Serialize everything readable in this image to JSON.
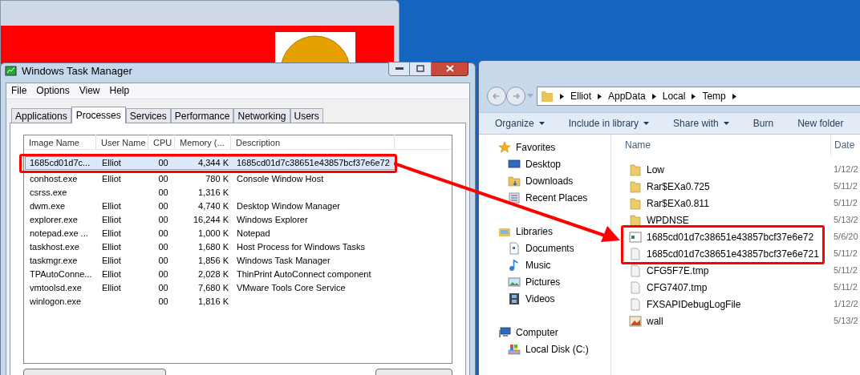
{
  "task_manager": {
    "title": "Windows Task Manager",
    "menu": [
      "File",
      "Options",
      "View",
      "Help"
    ],
    "tabs": [
      {
        "label": "Applications",
        "selected": false
      },
      {
        "label": "Processes",
        "selected": true
      },
      {
        "label": "Services",
        "selected": false
      },
      {
        "label": "Performance",
        "selected": false
      },
      {
        "label": "Networking",
        "selected": false
      },
      {
        "label": "Users",
        "selected": false
      }
    ],
    "columns": [
      "Image Name",
      "User Name",
      "CPU",
      "Memory (...",
      "Description"
    ],
    "rows": [
      {
        "cells": [
          "1685cd01d7c...",
          "Elliot",
          "00",
          "4,344 K",
          "1685cd01d7c38651e43857bcf37e6e72"
        ],
        "selected": true
      },
      {
        "cells": [
          "conhost.exe",
          "Elliot",
          "00",
          "780 K",
          "Console Window Host"
        ],
        "selected": false
      },
      {
        "cells": [
          "csrss.exe",
          "",
          "00",
          "1,316 K",
          ""
        ],
        "selected": false
      },
      {
        "cells": [
          "dwm.exe",
          "Elliot",
          "00",
          "4,740 K",
          "Desktop Window Manager"
        ],
        "selected": false
      },
      {
        "cells": [
          "explorer.exe",
          "Elliot",
          "00",
          "16,244 K",
          "Windows Explorer"
        ],
        "selected": false
      },
      {
        "cells": [
          "notepad.exe ...",
          "Elliot",
          "00",
          "1,000 K",
          "Notepad"
        ],
        "selected": false
      },
      {
        "cells": [
          "taskhost.exe",
          "Elliot",
          "00",
          "1,680 K",
          "Host Process for Windows Tasks"
        ],
        "selected": false
      },
      {
        "cells": [
          "taskmgr.exe",
          "Elliot",
          "00",
          "1,856 K",
          "Windows Task Manager"
        ],
        "selected": false
      },
      {
        "cells": [
          "TPAutoConne...",
          "Elliot",
          "00",
          "2,028 K",
          "ThinPrint AutoConnect component"
        ],
        "selected": false
      },
      {
        "cells": [
          "vmtoolsd.exe",
          "Elliot",
          "00",
          "7,680 K",
          "VMware Tools Core Service"
        ],
        "selected": false
      },
      {
        "cells": [
          "winlogon.exe",
          "",
          "00",
          "1,816 K",
          ""
        ],
        "selected": false
      }
    ]
  },
  "explorer": {
    "breadcrumb": [
      "Elliot",
      "AppData",
      "Local",
      "Temp"
    ],
    "toolbar": [
      {
        "label": "Organize",
        "dropdown": true
      },
      {
        "label": "Include in library",
        "dropdown": true
      },
      {
        "label": "Share with",
        "dropdown": true
      },
      {
        "label": "Burn",
        "dropdown": false
      },
      {
        "label": "New folder",
        "dropdown": false
      }
    ],
    "nav": [
      {
        "label": "Favorites",
        "kind": "favorites"
      },
      {
        "label": "Desktop",
        "kind": "desktop"
      },
      {
        "label": "Downloads",
        "kind": "folder"
      },
      {
        "label": "Recent Places",
        "kind": "recent"
      },
      {
        "label": "Libraries",
        "kind": "libraries"
      },
      {
        "label": "Documents",
        "kind": "document"
      },
      {
        "label": "Music",
        "kind": "music"
      },
      {
        "label": "Pictures",
        "kind": "picture"
      },
      {
        "label": "Videos",
        "kind": "video"
      },
      {
        "label": "Computer",
        "kind": "computer"
      },
      {
        "label": "Local Disk (C:)",
        "kind": "disk"
      }
    ],
    "columns": [
      "Name",
      "Date"
    ],
    "files": [
      {
        "name": "Low",
        "date": "1/12/2",
        "kind": "folder"
      },
      {
        "name": "Rar$EXa0.725",
        "date": "5/11/2",
        "kind": "folder"
      },
      {
        "name": "Rar$EXa0.811",
        "date": "5/11/2",
        "kind": "folder"
      },
      {
        "name": "WPDNSE",
        "date": "5/13/2",
        "kind": "folder"
      },
      {
        "name": "1685cd01d7c38651e43857bcf37e6e72",
        "date": "5/6/20",
        "kind": "program"
      },
      {
        "name": "1685cd01d7c38651e43857bcf37e6e721",
        "date": "5/11/2",
        "kind": "file"
      },
      {
        "name": "CFG5F7E.tmp",
        "date": "5/11/2",
        "kind": "file"
      },
      {
        "name": "CFG7407.tmp",
        "date": "5/11/2",
        "kind": "file"
      },
      {
        "name": "FXSAPIDebugLogFile",
        "date": "1/12/2",
        "kind": "file"
      },
      {
        "name": "wall",
        "date": "5/13/2",
        "kind": "image"
      }
    ]
  }
}
